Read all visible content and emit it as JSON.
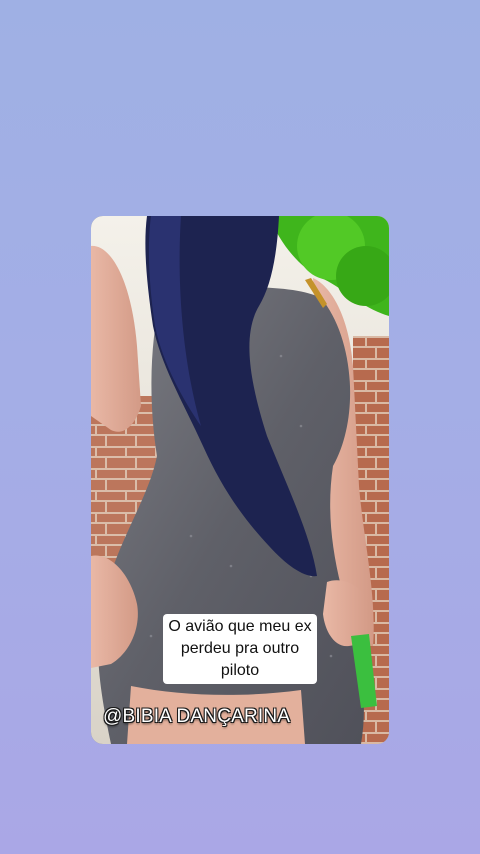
{
  "story": {
    "caption_lines": [
      "O avião que meu ex",
      "perdeu pra outro",
      "piloto"
    ],
    "handle": "@BIBIA DANÇARINA"
  },
  "colors": {
    "background": "#a4aee6",
    "caption_bg": "#ffffff",
    "caption_text": "#111111",
    "handle_text": "#ffffff"
  }
}
